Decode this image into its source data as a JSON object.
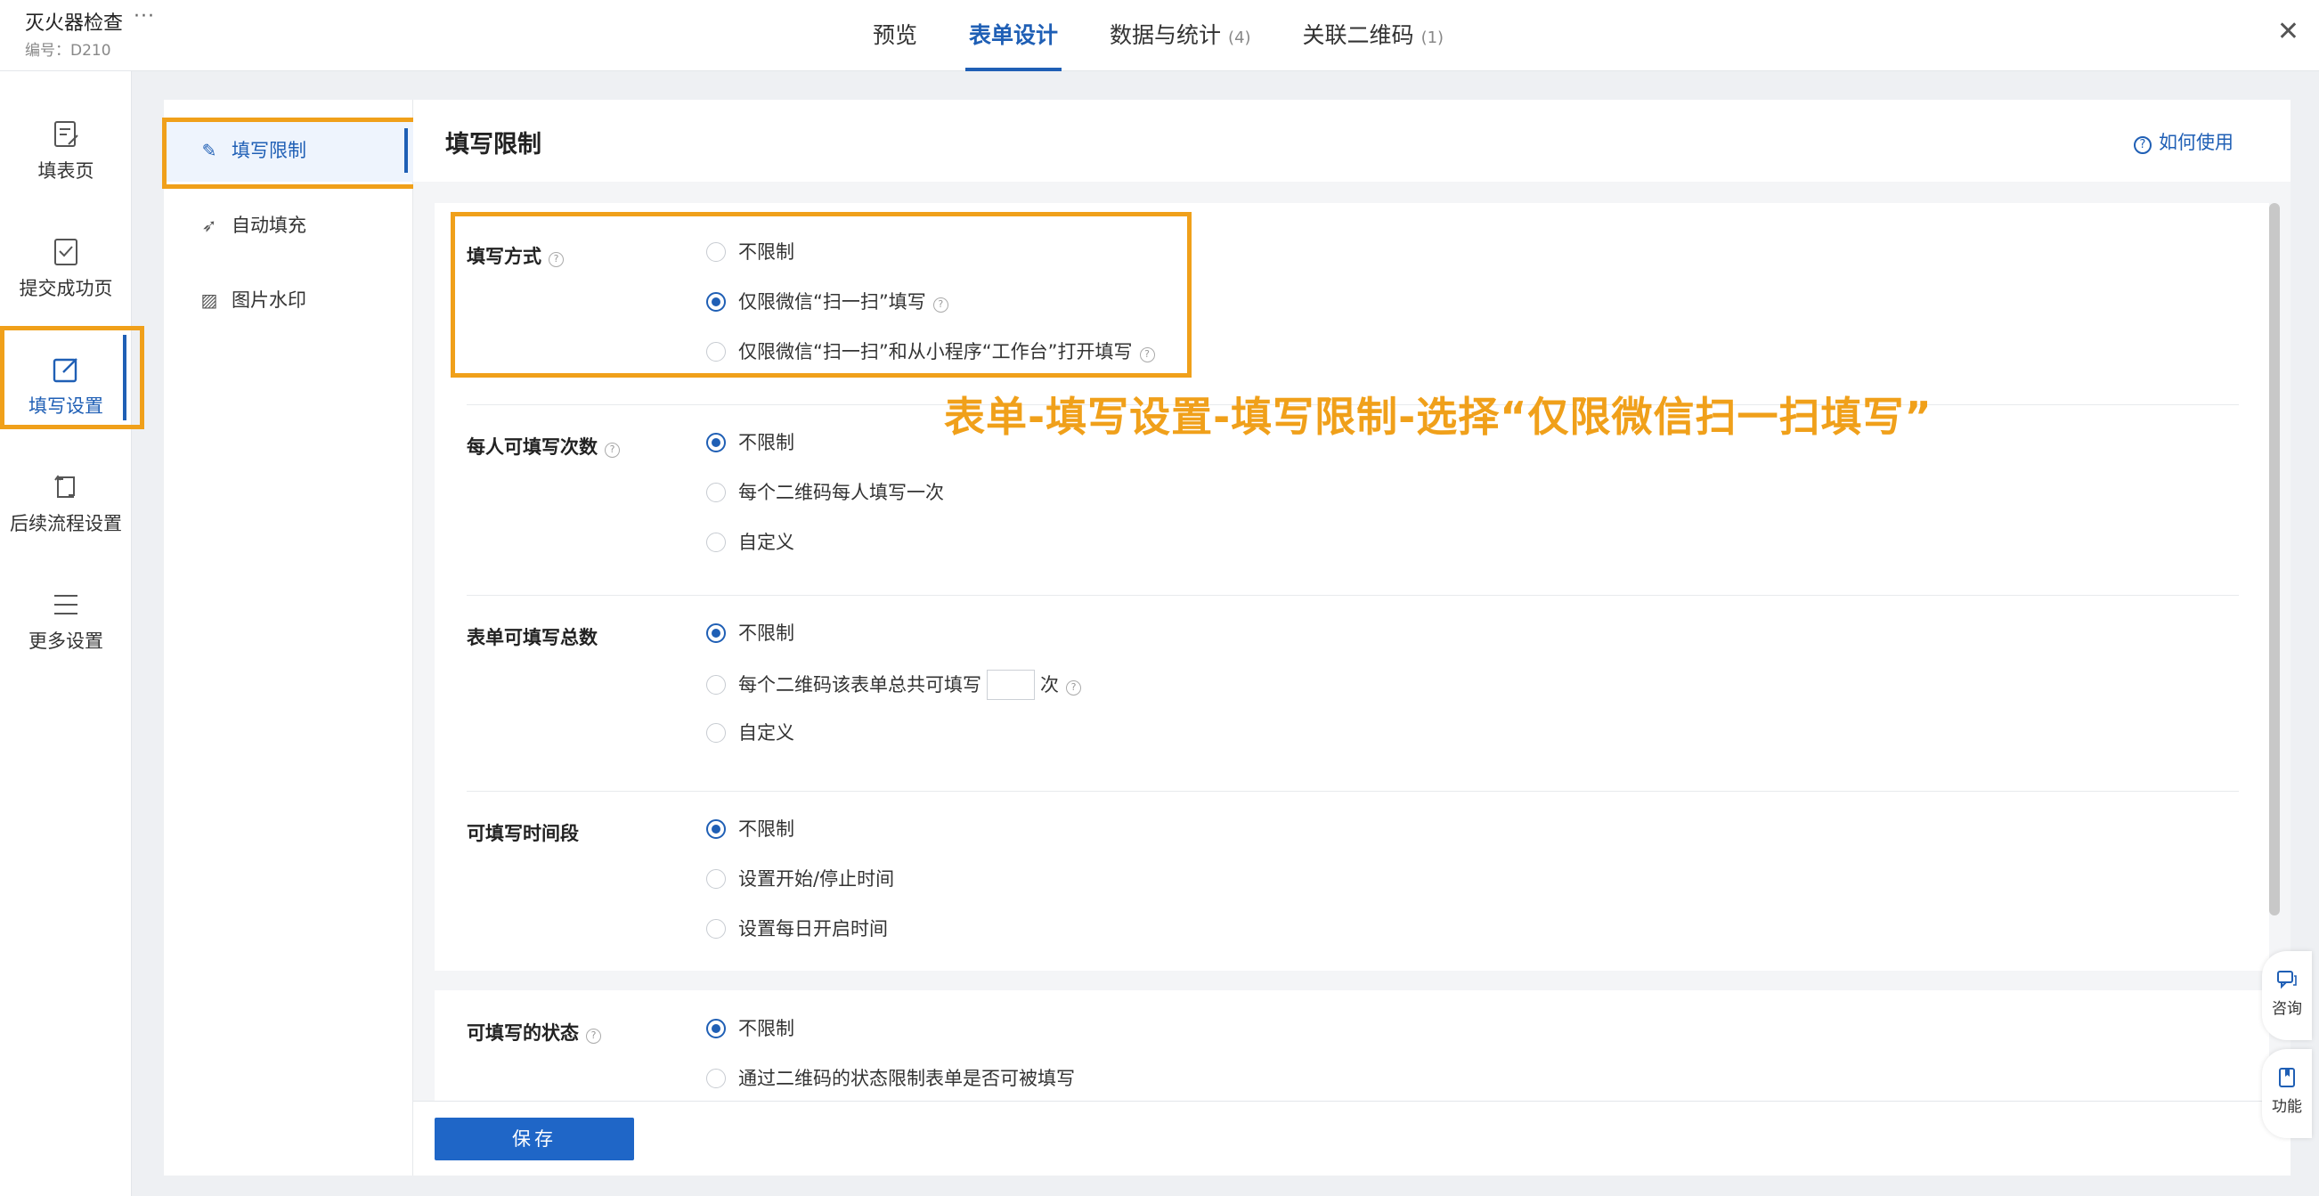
{
  "header": {
    "title": "灭火器检查",
    "more": "···",
    "code": "编号：D210",
    "tabs": [
      {
        "label": "预览",
        "count": ""
      },
      {
        "label": "表单设计",
        "count": ""
      },
      {
        "label": "数据与统计",
        "count": "(4)"
      },
      {
        "label": "关联二维码",
        "count": "(1)"
      }
    ],
    "close": "✕"
  },
  "leftnav": {
    "items": [
      {
        "label": "填表页",
        "icon": "form-page-icon"
      },
      {
        "label": "提交成功页",
        "icon": "submit-success-icon"
      },
      {
        "label": "填写设置",
        "icon": "edit-icon"
      },
      {
        "label": "后续流程设置",
        "icon": "workflow-icon"
      },
      {
        "label": "更多设置",
        "icon": "menu-icon"
      }
    ],
    "active": "填写设置"
  },
  "submenu": {
    "items": [
      {
        "label": "填写限制",
        "icon": "edit-square-icon"
      },
      {
        "label": "自动填充",
        "icon": "rocket-icon"
      },
      {
        "label": "图片水印",
        "icon": "image-icon"
      }
    ],
    "active": "填写限制"
  },
  "content": {
    "title": "填写限制",
    "help": "如何使用",
    "sections": [
      {
        "label": "填写方式",
        "options": [
          "不限制",
          "仅限微信“扫一扫”填写",
          "仅限微信“扫一扫”和从小程序“工作台”打开填写"
        ],
        "selected": 1
      },
      {
        "label": "每人可填写次数",
        "options": [
          "不限制",
          "每个二维码每人填写一次",
          "自定义"
        ],
        "selected": 0
      },
      {
        "label": "表单可填写总数",
        "options": [
          "不限制",
          "每个二维码该表单总共可填写",
          "自定义"
        ],
        "option_suffix": "次",
        "selected": 0
      },
      {
        "label": "可填写时间段",
        "options": [
          "不限制",
          "设置开始/停止时间",
          "设置每日开启时间"
        ],
        "selected": 0
      },
      {
        "label": "可填写的状态",
        "options": [
          "不限制",
          "通过二维码的状态限制表单是否可被填写"
        ],
        "selected": 0
      }
    ]
  },
  "annotation": "表单-填写设置-填写限制-选择“仅限微信扫一扫填写”",
  "footer": {
    "save": "保存"
  },
  "float": {
    "consult": "咨询",
    "function": "功能"
  },
  "colors": {
    "accent": "#1f5fb5",
    "highlight": "#f0a01a"
  }
}
